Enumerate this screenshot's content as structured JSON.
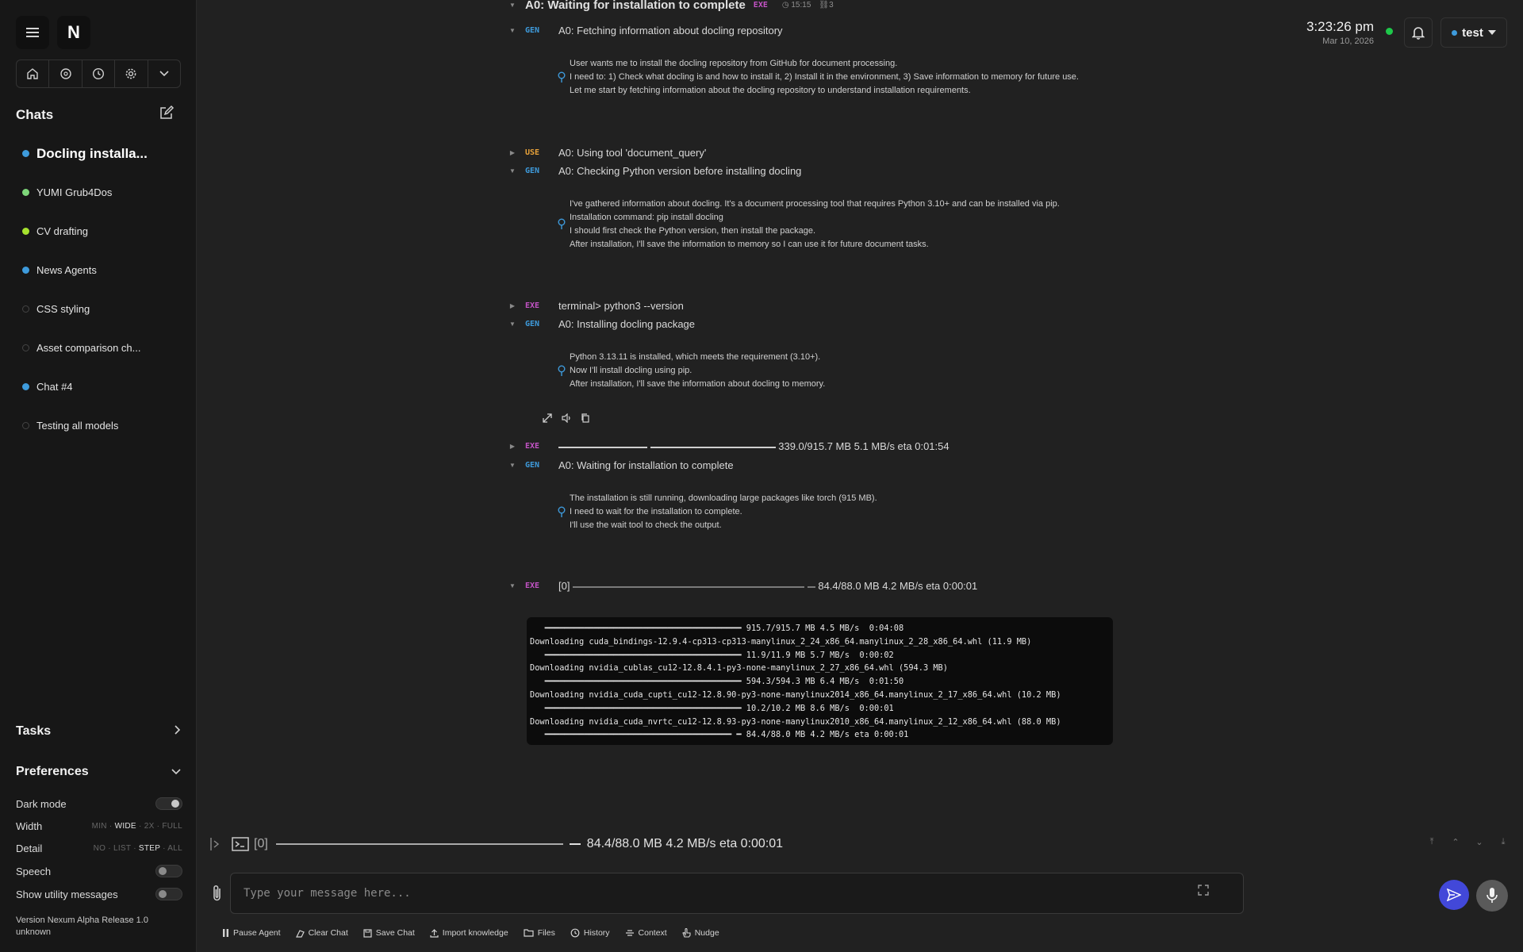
{
  "app": {
    "logo": "N"
  },
  "sidebar": {
    "chats_title": "Chats",
    "chats": [
      {
        "label": "Docling installa...",
        "dot": "#3e9bdc",
        "active": true
      },
      {
        "label": "YUMI Grub4Dos",
        "dot": "#7ed67a"
      },
      {
        "label": "CV drafting",
        "dot": "#a6e22e"
      },
      {
        "label": "News Agents",
        "dot": "#3e9bdc"
      },
      {
        "label": "CSS styling",
        "dot": "hollow"
      },
      {
        "label": "Asset comparison ch...",
        "dot": "hollow"
      },
      {
        "label": "Chat #4",
        "dot": "#3e9bdc"
      },
      {
        "label": "Testing all models",
        "dot": "hollow"
      }
    ],
    "tasks_title": "Tasks",
    "preferences_title": "Preferences",
    "prefs": {
      "dark_mode": "Dark mode",
      "width": "Width",
      "width_options": [
        "MIN",
        "WIDE",
        "2X",
        "FULL"
      ],
      "width_selected": "WIDE",
      "detail": "Detail",
      "detail_options": [
        "NO",
        "LIST",
        "STEP",
        "ALL"
      ],
      "detail_selected": "STEP",
      "speech": "Speech",
      "utility": "Show utility messages"
    },
    "version_line1": "Version Nexum Alpha Release 1.0",
    "version_line2": "unknown"
  },
  "header": {
    "time": "3:23:26 pm",
    "date": "Mar 10, 2026",
    "user": "test",
    "status_color": "#1ec84a"
  },
  "log": {
    "top_row": {
      "tag": "EXE",
      "text": "A0: Waiting for installation to complete",
      "tag2": "EXE",
      "timer": "15:15",
      "count": "3"
    },
    "r1": {
      "tag": "GEN",
      "text": "A0: Fetching information about docling repository"
    },
    "t1": [
      "User wants me to install the docling repository from GitHub for document processing.",
      "I need to: 1) Check what docling is and how to install it, 2) Install it in the environment, 3) Save information to memory for future use.",
      "Let me start by fetching information about the docling repository to understand installation requirements."
    ],
    "r2": {
      "tag": "USE",
      "text": "A0: Using tool 'document_query'"
    },
    "r3": {
      "tag": "GEN",
      "text": "A0: Checking Python version before installing docling"
    },
    "t3": [
      "I've gathered information about docling. It's a document processing tool that requires Python 3.10+ and can be installed via pip.",
      "Installation command: pip install docling",
      "I should first check the Python version, then install the package.",
      "After installation, I'll save the information to memory so I can use it for future document tasks."
    ],
    "r4": {
      "tag": "EXE",
      "text": "terminal> python3 --version"
    },
    "r5": {
      "tag": "GEN",
      "text": "A0: Installing docling package"
    },
    "t5": [
      "Python 3.13.11 is installed, which meets the requirement (3.10+).",
      "Now I'll install docling using pip.",
      "After installation, I'll save the information about docling to memory."
    ],
    "r6": {
      "tag": "EXE",
      "text": "339.0/915.7 MB 5.1 MB/s eta 0:01:54"
    },
    "r7": {
      "tag": "GEN",
      "text": "A0: Waiting for installation to complete"
    },
    "t7": [
      "The installation is still running, downloading large packages like torch (915 MB).",
      "I need to wait for the installation to complete.",
      "I'll use the wait tool to check the output."
    ],
    "r8": {
      "tag": "EXE",
      "prefix": "[0]",
      "text": "84.4/88.0 MB 4.2 MB/s eta 0:00:01"
    }
  },
  "terminal": [
    "   ━━━━━━━━━━━━━━━━━━━━━━━━━━━━━━━━━━━━━━━━ 915.7/915.7 MB 4.5 MB/s  0:04:08",
    "Downloading cuda_bindings-12.9.4-cp313-cp313-manylinux_2_24_x86_64.manylinux_2_28_x86_64.whl (11.9 MB)",
    "   ━━━━━━━━━━━━━━━━━━━━━━━━━━━━━━━━━━━━━━━━ 11.9/11.9 MB 5.7 MB/s  0:00:02",
    "Downloading nvidia_cublas_cu12-12.8.4.1-py3-none-manylinux_2_27_x86_64.whl (594.3 MB)",
    "   ━━━━━━━━━━━━━━━━━━━━━━━━━━━━━━━━━━━━━━━━ 594.3/594.3 MB 6.4 MB/s  0:01:50",
    "Downloading nvidia_cuda_cupti_cu12-12.8.90-py3-none-manylinux2014_x86_64.manylinux_2_17_x86_64.whl (10.2 MB)",
    "   ━━━━━━━━━━━━━━━━━━━━━━━━━━━━━━━━━━━━━━━━ 10.2/10.2 MB 8.6 MB/s  0:00:01",
    "Downloading nvidia_cuda_nvrtc_cu12-12.8.93-py3-none-manylinux2010_x86_64.manylinux_2_12_x86_64.whl (88.0 MB)",
    "   ━━━━━━━━━━━━━━━━━━━━━━━━━━━━━━━━━━━━━━ ━ 84.4/88.0 MB 4.2 MB/s eta 0:00:01"
  ],
  "bottom": {
    "status_prefix": "[0]",
    "status_text": "84.4/88.0 MB 4.2 MB/s eta 0:00:01",
    "placeholder": "Type your message here...",
    "actions": [
      "Pause Agent",
      "Clear Chat",
      "Save Chat",
      "Import knowledge",
      "Files",
      "History",
      "Context",
      "Nudge"
    ]
  }
}
